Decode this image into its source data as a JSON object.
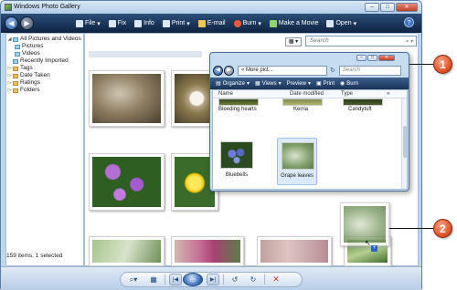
{
  "window": {
    "title": "Windows Photo Gallery",
    "controls": {
      "minimize": "–",
      "maximize": "□",
      "close": "✕"
    }
  },
  "toolbar": {
    "items": [
      {
        "label": "File",
        "icon": "file-icon"
      },
      {
        "label": "Fix",
        "icon": "fix-icon"
      },
      {
        "label": "Info",
        "icon": "info-icon"
      },
      {
        "label": "Print",
        "icon": "print-icon"
      },
      {
        "label": "E-mail",
        "icon": "email-icon"
      },
      {
        "label": "Burn",
        "icon": "burn-icon"
      },
      {
        "label": "Make a Movie",
        "icon": "movie-icon"
      },
      {
        "label": "Open",
        "icon": "open-icon"
      }
    ],
    "help": "?"
  },
  "search": {
    "placeholder": "Search",
    "icon": "search-icon"
  },
  "view_button": "▦ ▾",
  "nav_tree": [
    {
      "label": "All Pictures and Videos",
      "level": 0,
      "expanded": true
    },
    {
      "label": "Pictures",
      "level": 1
    },
    {
      "label": "Videos",
      "level": 1
    },
    {
      "label": "Recently Imported",
      "level": 0
    },
    {
      "label": "Tags",
      "level": 0
    },
    {
      "label": "Date Taken",
      "level": 0
    },
    {
      "label": "Ratings",
      "level": 0
    },
    {
      "label": "Folders",
      "level": 0
    }
  ],
  "status": {
    "text": "159 items, 1 selected"
  },
  "bottom_controls": [
    "zoom",
    "grid",
    "previous",
    "slideshow",
    "next",
    "rotate-left",
    "rotate-right",
    "delete"
  ],
  "explorer": {
    "path": "« More pict...",
    "search_placeholder": "Search",
    "toolbar": [
      "Organize",
      "Views",
      "Preview",
      "Print",
      "Burn"
    ],
    "columns": [
      "Name",
      "Date modified",
      "Type"
    ],
    "top_items": [
      "Bleeding hearts",
      "Kerria",
      "Candytuft"
    ],
    "items": [
      {
        "label": "Bluebells",
        "selected": false
      },
      {
        "label": "Grape leaves",
        "selected": true
      }
    ]
  },
  "callouts": [
    "1",
    "2"
  ]
}
